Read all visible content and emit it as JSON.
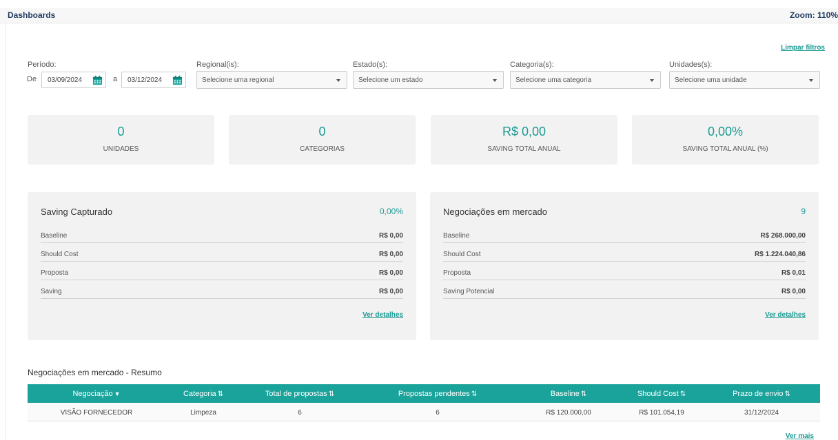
{
  "header": {
    "title": "Dashboards",
    "zoom": "Zoom: 110%"
  },
  "filters": {
    "clear_label": "Limpar filtros",
    "period_label": "Período:",
    "from_label": "De",
    "from_value": "03/09/2024",
    "to_label": "a",
    "to_value": "03/12/2024",
    "regional_label": "Regional(is):",
    "regional_placeholder": "Selecione uma regional",
    "estado_label": "Estado(s):",
    "estado_placeholder": "Selecione um estado",
    "categoria_label": "Categoria(s):",
    "categoria_placeholder": "Selecione uma categoria",
    "unidades_label": "Unidades(s):",
    "unidades_placeholder": "Selecione uma unidade"
  },
  "stats": [
    {
      "value": "0",
      "label": "UNIDADES"
    },
    {
      "value": "0",
      "label": "CATEGORIAS"
    },
    {
      "value": "R$ 0,00",
      "label": "SAVING TOTAL ANUAL"
    },
    {
      "value": "0,00%",
      "label": "SAVING TOTAL ANUAL (%)"
    }
  ],
  "saving_panel": {
    "title": "Saving Capturado",
    "value": "0,00%",
    "rows": [
      {
        "label": "Baseline",
        "value": "R$ 0,00"
      },
      {
        "label": "Should Cost",
        "value": "R$ 0,00"
      },
      {
        "label": "Proposta",
        "value": "R$ 0,00"
      },
      {
        "label": "Saving",
        "value": "R$ 0,00"
      }
    ],
    "details_label": "Ver detalhes"
  },
  "market_panel": {
    "title": "Negociações em mercado",
    "value": "9",
    "rows": [
      {
        "label": "Baseline",
        "value": "R$ 268.000,00"
      },
      {
        "label": "Should Cost",
        "value": "R$ 1.224.040,86"
      },
      {
        "label": "Proposta",
        "value": "R$ 0,01"
      },
      {
        "label": "Saving Potencial",
        "value": "R$ 0,00"
      }
    ],
    "details_label": "Ver detalhes"
  },
  "summary": {
    "title": "Negociações em mercado - Resumo",
    "columns": [
      "Negociação",
      "Categoria",
      "Total de propostas",
      "Propostas pendentes",
      "Baseline",
      "Should Cost",
      "Prazo de envio"
    ],
    "rows": [
      [
        "VISÃO FORNECEDOR",
        "Limpeza",
        "6",
        "6",
        "R$ 120.000,00",
        "R$ 101.054,19",
        "31/12/2024"
      ]
    ],
    "more_label": "Ver mais"
  },
  "colors": {
    "accent": "#1aa39b",
    "title": "#1f3a5f",
    "card_bg": "#f2f2f2"
  },
  "icons": {
    "calendar": "calendar-icon",
    "caret": "chevron-down-icon",
    "sort": "sort-icon",
    "filter": "filter-icon"
  }
}
